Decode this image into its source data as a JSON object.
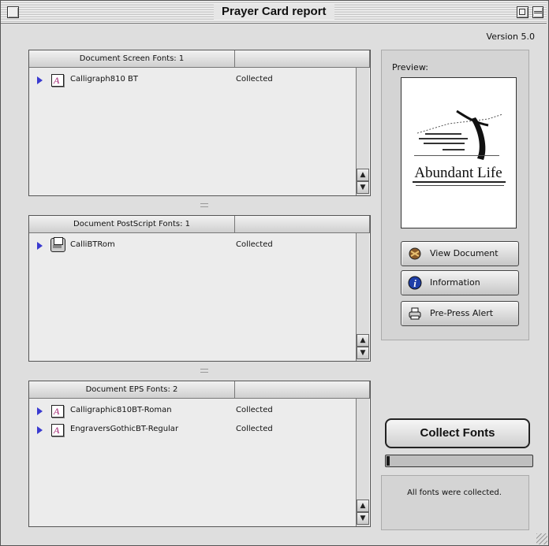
{
  "window": {
    "title": "Prayer Card report",
    "version": "Version 5.0"
  },
  "screen_fonts": {
    "header": "Document Screen Fonts: 1",
    "rows": [
      {
        "name": "Calligraph810 BT",
        "status": "Collected",
        "icon": "font-file-icon"
      }
    ]
  },
  "postscript_fonts": {
    "header": "Document PostScript Fonts: 1",
    "rows": [
      {
        "name": "CalliBTRom",
        "status": "Collected",
        "icon": "postscript-printer-font-icon"
      }
    ]
  },
  "eps_fonts": {
    "header": "Document EPS Fonts: 2",
    "rows": [
      {
        "name": "Calligraphic810BT-Roman",
        "status": "Collected",
        "icon": "font-file-icon"
      },
      {
        "name": "EngraversGothicBT-Regular",
        "status": "Collected",
        "icon": "font-file-icon"
      }
    ]
  },
  "preview": {
    "label": "Preview:",
    "thumbnail_text": "Abundant Life"
  },
  "buttons": {
    "view_document": "View Document",
    "information": "Information",
    "pre_press_alert": "Pre-Press Alert",
    "collect_fonts": "Collect Fonts"
  },
  "progress": {
    "fraction": 0.02
  },
  "status": {
    "message": "All fonts were collected."
  },
  "colors": {
    "disclosure_triangle": "#3a3ad0",
    "font_icon_glyph": "#a02070"
  }
}
